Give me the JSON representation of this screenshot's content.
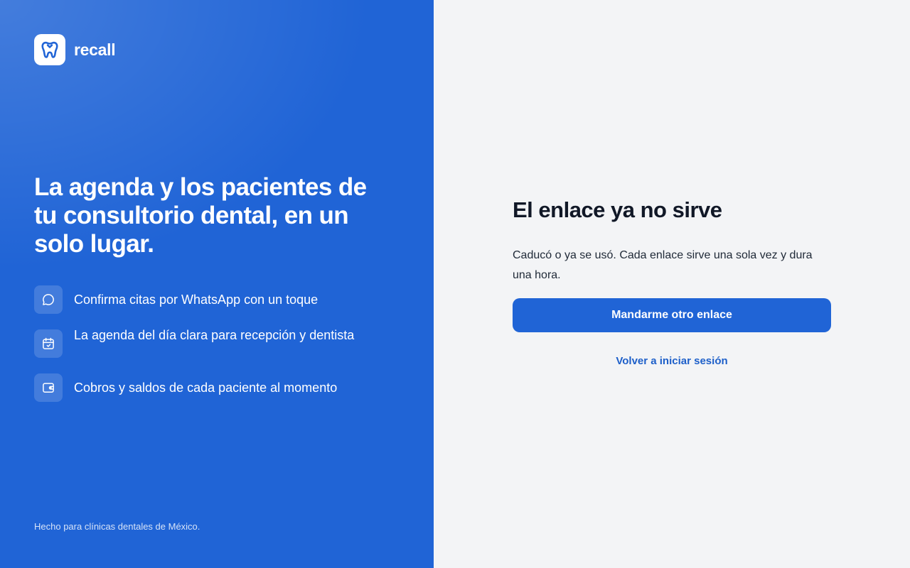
{
  "brand": {
    "name": "recall",
    "logo_icon": "tooth-icon"
  },
  "hero": {
    "headline": "La agenda y los pacientes de tu consultorio dental, en un solo lugar."
  },
  "features": [
    {
      "icon": "chat-bubble-icon",
      "text": "Confirma citas por WhatsApp con un toque"
    },
    {
      "icon": "calendar-check-icon",
      "text": "La agenda del día clara para recepción y dentista"
    },
    {
      "icon": "wallet-icon",
      "text": "Cobros y saldos de cada paciente al momento"
    }
  ],
  "footer": {
    "note": "Hecho para clínicas dentales de México."
  },
  "main": {
    "title": "El enlace ya no sirve",
    "message": "Caducó o ya se usó. Cada enlace sirve una sola vez y dura una hora.",
    "primary_button": "Mandarme otro enlace",
    "back_link": "Volver a iniciar sesión"
  },
  "colors": {
    "brand_blue": "#2064d6",
    "panel_background": "#f3f4f6",
    "title_text": "#111827",
    "link_blue": "#1d5fc9"
  }
}
